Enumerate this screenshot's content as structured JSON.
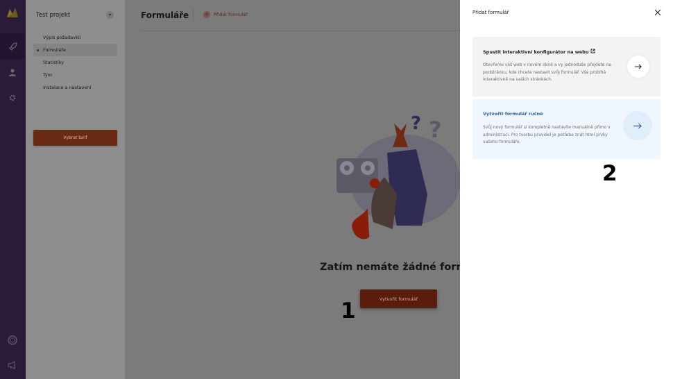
{
  "sidebar": {
    "project_name": "Test projekt",
    "items": [
      {
        "label": "Výpis požadavků"
      },
      {
        "label": "Formuláře"
      },
      {
        "label": "Statistiky"
      },
      {
        "label": "Tým"
      },
      {
        "label": "Instalace a nastavení"
      }
    ],
    "tarif_button": "Vybrat tarif"
  },
  "main": {
    "title": "Formuláře",
    "add_link": "Přidat formulář",
    "empty_title": "Zatím nemáte žádné formuláře",
    "create_button": "Vytvořit formulář",
    "annotation": "1"
  },
  "panel": {
    "title": "Přidat formulář",
    "card1": {
      "title": "Spustit interaktivní konfigurátor na webu",
      "description": "Otevřeme váš web v novém okně a vy jednoduše přejdete na podstránku, kde chcete nastavit svůj formulář. Vše probíhá interaktivně na vašich stránkách."
    },
    "card2": {
      "title": "Vytvořit formulář ručně",
      "description": "Svůj nový formulář si kompletně nastavíte manuálně přímo v administraci. Pro tvorbu pravidel je potřeba znát html prvky vašeho formuláře."
    },
    "annotation": "2"
  },
  "colors": {
    "accent_orange": "#e8501f",
    "accent_blue": "#2d63b3",
    "rail": "#2b1b3b"
  },
  "icons": [
    "logo-icon",
    "rocket-icon",
    "user-icon",
    "gear-icon",
    "help-ring-icon",
    "megaphone-icon",
    "chevron-down-icon",
    "plus-icon",
    "close-icon",
    "external-link-icon",
    "arrow-right-icon"
  ]
}
